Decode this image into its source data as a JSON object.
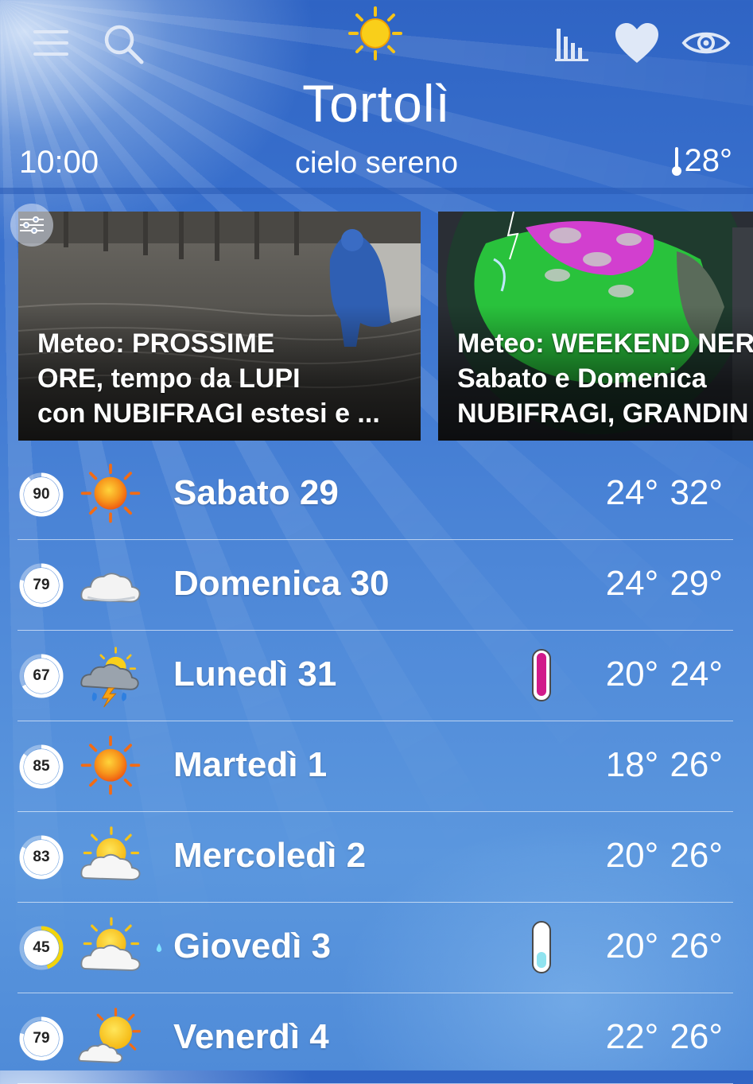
{
  "header": {
    "city": "Tortolì",
    "time": "10:00",
    "condition": "cielo sereno",
    "temperature": "28°",
    "current_icon": "sun-icon",
    "actions": [
      "menu-icon",
      "search-icon",
      "chart-icon",
      "heart-icon",
      "eye-icon"
    ]
  },
  "news": [
    {
      "text": "Meteo: PROSSIME\nORE, tempo da LUPI\ncon NUBIFRAGI estesi e ..."
    },
    {
      "text": "Meteo: WEEKEND NER\nSabato e Domenica\nNUBIFRAGI, GRANDIN"
    }
  ],
  "days": [
    {
      "label": "Sabato 29",
      "badge": "90",
      "reliability": 0.9,
      "icon": "sun-icon",
      "temps": "24° 32°",
      "thermo": null,
      "rain_drop": false
    },
    {
      "label": "Domenica 30",
      "badge": "79",
      "reliability": 0.79,
      "icon": "cloud-icon",
      "temps": "24° 29°",
      "thermo": null,
      "rain_drop": false
    },
    {
      "label": "Lunedì 31",
      "badge": "67",
      "reliability": 0.67,
      "icon": "storm-icon",
      "temps": "20° 24°",
      "thermo": "#d11a8a",
      "rain_drop": false
    },
    {
      "label": "Martedì 1",
      "badge": "85",
      "reliability": 0.85,
      "icon": "sun-icon",
      "temps": "18° 26°",
      "thermo": null,
      "rain_drop": false
    },
    {
      "label": "Mercoledì 2",
      "badge": "83",
      "reliability": 0.83,
      "icon": "partly-cloudy-icon",
      "temps": "20° 26°",
      "thermo": null,
      "rain_drop": false
    },
    {
      "label": "Giovedì 3",
      "badge": "45",
      "reliability": 0.45,
      "icon": "partly-cloudy-icon",
      "temps": "20° 26°",
      "thermo": "#8fe3ef",
      "rain_drop": true
    },
    {
      "label": "Venerdì 4",
      "badge": "79",
      "reliability": 0.79,
      "icon": "sun-cloud-icon",
      "temps": "22° 26°",
      "thermo": null,
      "rain_drop": false
    }
  ],
  "colors": {
    "badge_ring": "#ffffff",
    "badge_ring_low": "#f2d40b",
    "sun": "#f7c416",
    "sun_orange": "#f26b14"
  }
}
